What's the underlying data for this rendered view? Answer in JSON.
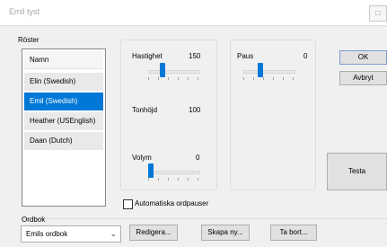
{
  "window": {
    "title": "Emil tyst",
    "control_glyph": "□"
  },
  "voices": {
    "label": "Röster",
    "header": "Namn",
    "items": [
      "Elin (Swedish)",
      "Emil (Swedish)",
      "Heather (USEnglish)",
      "Daan (Dutch)"
    ],
    "selected_index": 1
  },
  "speed": {
    "label": "Hastighet",
    "value": "150",
    "slider_fraction": 0.28
  },
  "pitch": {
    "label": "Tonhöjd",
    "value": "100"
  },
  "pause": {
    "label": "Paus",
    "value": "0",
    "slider_fraction": 0.32
  },
  "volume": {
    "label": "Volym",
    "value": "0",
    "slider_fraction": 0.05
  },
  "auto_pause_label": "Automatiska ordpauser",
  "buttons": {
    "ok": "OK",
    "cancel": "Avbryt",
    "test": "Testa",
    "edit": "Redigera...",
    "create_new": "Skapa ny...",
    "delete": "Ta bort..."
  },
  "dictionary": {
    "label": "Ordbok",
    "selected": "Emils ordbok"
  },
  "colors": {
    "selection": "#0078d7",
    "slider_thumb": "#0078d7"
  }
}
